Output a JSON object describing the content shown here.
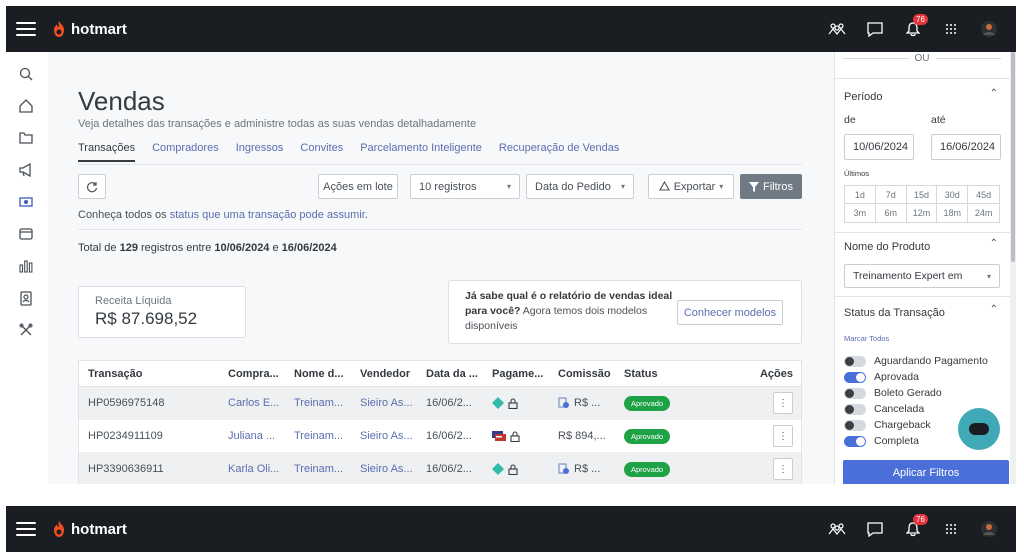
{
  "brand": {
    "name": "hotmart",
    "flame_color": "#f04e23"
  },
  "topbar": {
    "notifications_count": "76"
  },
  "page": {
    "title": "Vendas",
    "subtitle": "Veja detalhes das transações e administre todas as suas vendas detalhadamente",
    "tabs": [
      {
        "label": "Transações"
      },
      {
        "label": "Compradores"
      },
      {
        "label": "Ingressos"
      },
      {
        "label": "Convites"
      },
      {
        "label": "Parcelamento Inteligente"
      },
      {
        "label": "Recuperação de Vendas"
      }
    ]
  },
  "toolbar": {
    "batch_actions": "Ações em lote",
    "records_select": "10 registros",
    "date_select": "Data do Pedido",
    "export": "Exportar",
    "filters": "Filtros"
  },
  "hint": {
    "prefix": "Conheça todos os ",
    "link": "status que uma transação pode assumir",
    "suffix": "."
  },
  "summary": {
    "prefix": "Total de ",
    "count": "129",
    "mid": " registros entre ",
    "start": "10/06/2024",
    "and": " e ",
    "end": "16/06/2024"
  },
  "revenue": {
    "label": "Receita Líquida",
    "value": "R$ 87.698,52"
  },
  "report_card": {
    "bold": "Já sabe qual é o relatório de vendas ideal para você?",
    "text": " Agora temos dois modelos disponíveis",
    "button": "Conhecer modelos"
  },
  "table": {
    "headers": [
      "Transação",
      "Compra...",
      "Nome d...",
      "Vendedor",
      "Data da ...",
      "Pagame...",
      "Comissão",
      "Status",
      "Ações"
    ],
    "rows": [
      {
        "id": "HP0596975148",
        "buyer": "Carlos E...",
        "product": "Treinam...",
        "seller": "Sieiro As...",
        "date": "16/06/2...",
        "commission": "R$ ...",
        "status": "Aprovado",
        "pay": "pix"
      },
      {
        "id": "HP0234911109",
        "buyer": "Juliana ...",
        "product": "Treinam...",
        "seller": "Sieiro As...",
        "date": "16/06/2...",
        "commission": "R$ 894,...",
        "status": "Aprovado",
        "pay": "card"
      },
      {
        "id": "HP3390636911",
        "buyer": "Karla Oli...",
        "product": "Treinam...",
        "seller": "Sieiro As...",
        "date": "16/06/2...",
        "commission": "R$ ...",
        "status": "Aprovado",
        "pay": "pix"
      }
    ]
  },
  "filters_panel": {
    "ou": "OU",
    "period_title": "Período",
    "from_label": "de",
    "to_label": "até",
    "from_value": "10/06/2024",
    "to_value": "16/06/2024",
    "last_label": "Últimos",
    "quick_ranges": [
      "1d",
      "7d",
      "15d",
      "30d",
      "45d",
      "3m",
      "6m",
      "12m",
      "18m",
      "24m"
    ],
    "product_title": "Nome do Produto",
    "product_value": "Treinamento Expert em",
    "status_title": "Status da Transação",
    "select_all": "Marcar Todos",
    "statuses": [
      {
        "label": "Aguardando Pagamento",
        "on": false
      },
      {
        "label": "Aprovada",
        "on": true
      },
      {
        "label": "Boleto Gerado",
        "on": false
      },
      {
        "label": "Cancelada",
        "on": false
      },
      {
        "label": "Chargeback",
        "on": false
      },
      {
        "label": "Completa",
        "on": true
      }
    ],
    "apply": "Aplicar Filtros"
  }
}
